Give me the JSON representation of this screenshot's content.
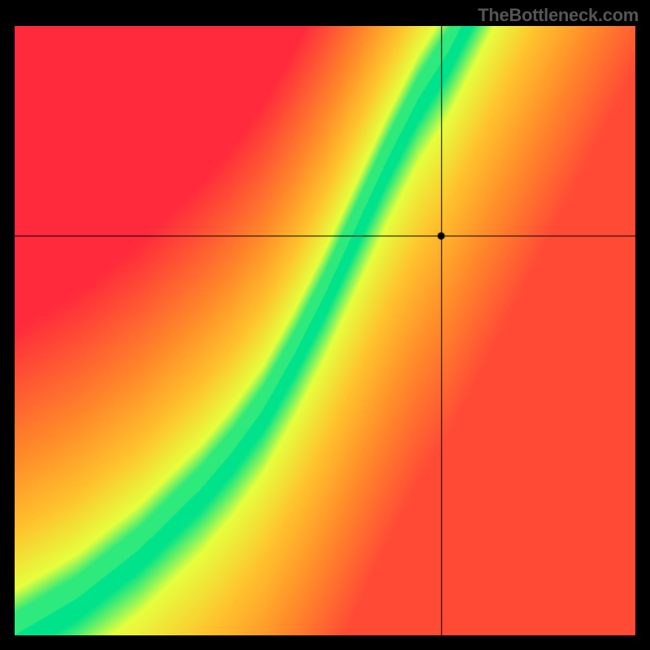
{
  "watermark": "TheBottleneck.com",
  "chart_data": {
    "type": "heatmap",
    "title": "",
    "xlabel": "",
    "ylabel": "",
    "xlim": [
      0,
      100
    ],
    "ylim": [
      0,
      100
    ],
    "crosshair": {
      "x": 68.8,
      "y": 65.5
    },
    "marker": {
      "x": 68.8,
      "y": 65.5
    },
    "optimal_curve_comment": "Green optimal band: y as a function of x (normalized 0..100). Above and to the left trends toward red; below-right trends toward red via yellow/orange.",
    "optimal_curve": [
      {
        "x": 0,
        "y": 0
      },
      {
        "x": 5,
        "y": 3
      },
      {
        "x": 10,
        "y": 6
      },
      {
        "x": 15,
        "y": 10
      },
      {
        "x": 20,
        "y": 14
      },
      {
        "x": 25,
        "y": 19
      },
      {
        "x": 30,
        "y": 24
      },
      {
        "x": 35,
        "y": 30
      },
      {
        "x": 40,
        "y": 37
      },
      {
        "x": 45,
        "y": 46
      },
      {
        "x": 50,
        "y": 56
      },
      {
        "x": 55,
        "y": 67
      },
      {
        "x": 60,
        "y": 78
      },
      {
        "x": 65,
        "y": 88
      },
      {
        "x": 70,
        "y": 96
      },
      {
        "x": 72,
        "y": 100
      }
    ],
    "band_halfwidth": 3.5,
    "colors": {
      "good": "#00E38A",
      "near": "#E6FF3E",
      "mid": "#FFC22D",
      "warm": "#FF8A2A",
      "bad": "#FF2A3C"
    }
  }
}
